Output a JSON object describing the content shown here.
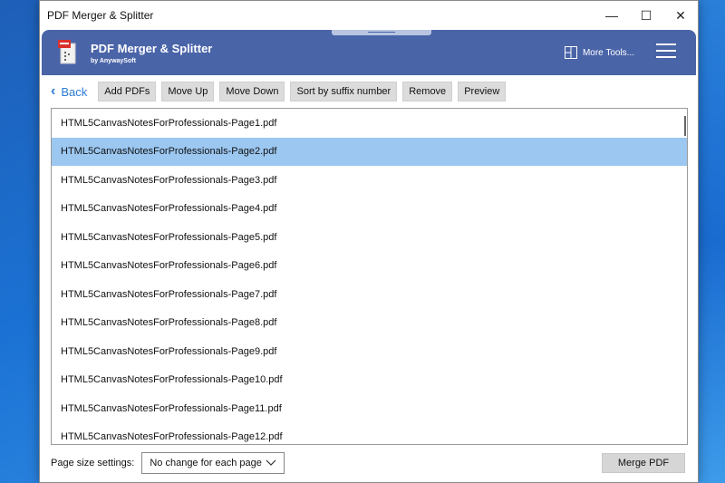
{
  "window": {
    "title": "PDF Merger & Splitter",
    "minimize_glyph": "—",
    "maximize_glyph": "☐",
    "close_glyph": "✕"
  },
  "appbar": {
    "app_name": "PDF Merger & Splitter",
    "publisher": "by AnywaySoft",
    "more_tools_label": "More Tools...",
    "accent_color": "#4a64a8"
  },
  "toolbar": {
    "back_label": "Back",
    "buttons": [
      "Add PDFs",
      "Move Up",
      "Move Down",
      "Sort by suffix number",
      "Remove",
      "Preview"
    ]
  },
  "files": [
    "HTML5CanvasNotesForProfessionals-Page1.pdf",
    "HTML5CanvasNotesForProfessionals-Page2.pdf",
    "HTML5CanvasNotesForProfessionals-Page3.pdf",
    "HTML5CanvasNotesForProfessionals-Page4.pdf",
    "HTML5CanvasNotesForProfessionals-Page5.pdf",
    "HTML5CanvasNotesForProfessionals-Page6.pdf",
    "HTML5CanvasNotesForProfessionals-Page7.pdf",
    "HTML5CanvasNotesForProfessionals-Page8.pdf",
    "HTML5CanvasNotesForProfessionals-Page9.pdf",
    "HTML5CanvasNotesForProfessionals-Page10.pdf",
    "HTML5CanvasNotesForProfessionals-Page11.pdf",
    "HTML5CanvasNotesForProfessionals-Page12.pdf"
  ],
  "selected_file_index": 1,
  "selection_color": "#9bc7f1",
  "footer": {
    "page_size_label": "Page size settings:",
    "page_size_value": "No change for each page",
    "merge_label": "Merge PDF"
  }
}
